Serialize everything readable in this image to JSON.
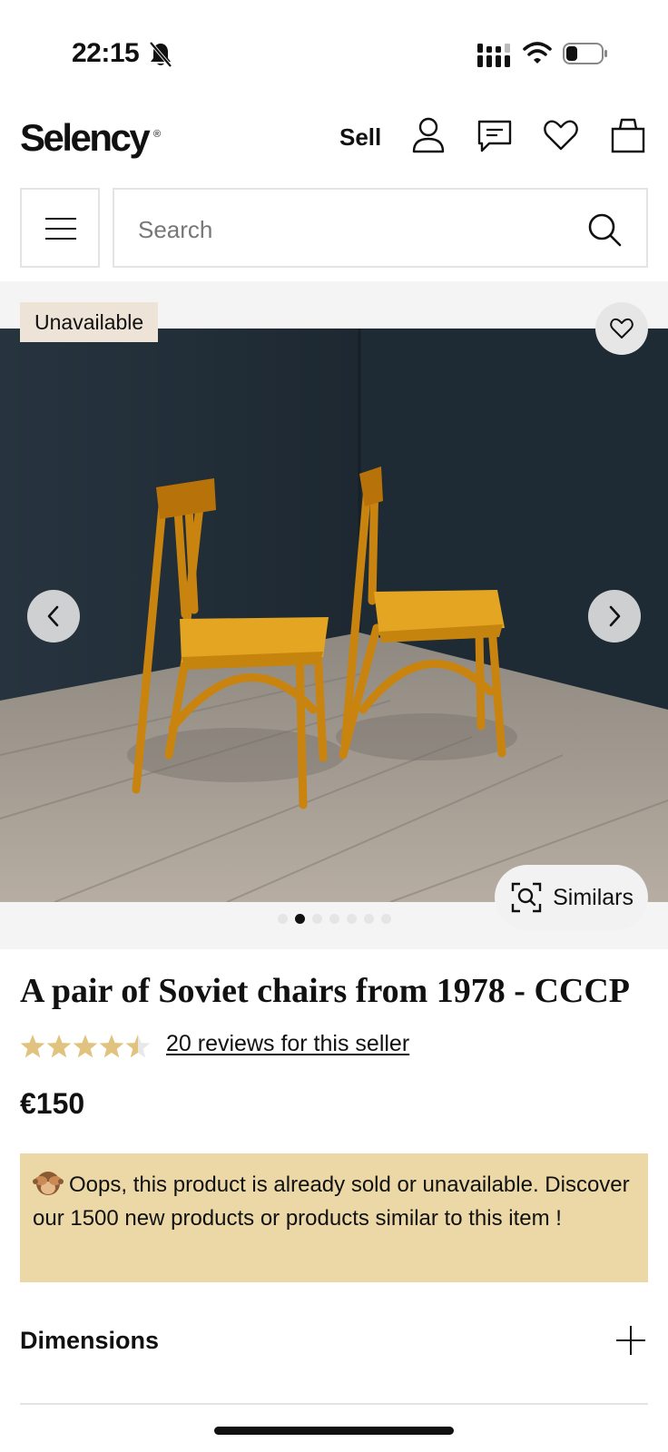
{
  "status_bar": {
    "time": "22:15",
    "icons": [
      "bell-slash-icon",
      "signal-icon",
      "wifi-icon",
      "battery-icon"
    ]
  },
  "header": {
    "logo": "Selency",
    "logo_mark": "®",
    "sell_label": "Sell",
    "icons": [
      "account-icon",
      "messages-icon",
      "favorites-icon",
      "cart-icon"
    ]
  },
  "search": {
    "placeholder": "Search"
  },
  "gallery": {
    "badge": "Unavailable",
    "similars_label": "Similars",
    "image_count": 7,
    "active_index": 1
  },
  "product": {
    "title": "A pair of Soviet chairs from 1978 - CCCP",
    "rating": 4.5,
    "rating_max": 5,
    "reviews_label": "20 reviews for this seller",
    "price": "€150"
  },
  "notice": {
    "text": "Oops, this product is already sold or unavailable. Discover our 1500 new products or products similar to this item !"
  },
  "accordion": {
    "dimensions_label": "Dimensions"
  },
  "colors": {
    "badge_bg": "#ede3d6",
    "notice_bg": "#ecd8a6",
    "star": "#e1c27e"
  }
}
